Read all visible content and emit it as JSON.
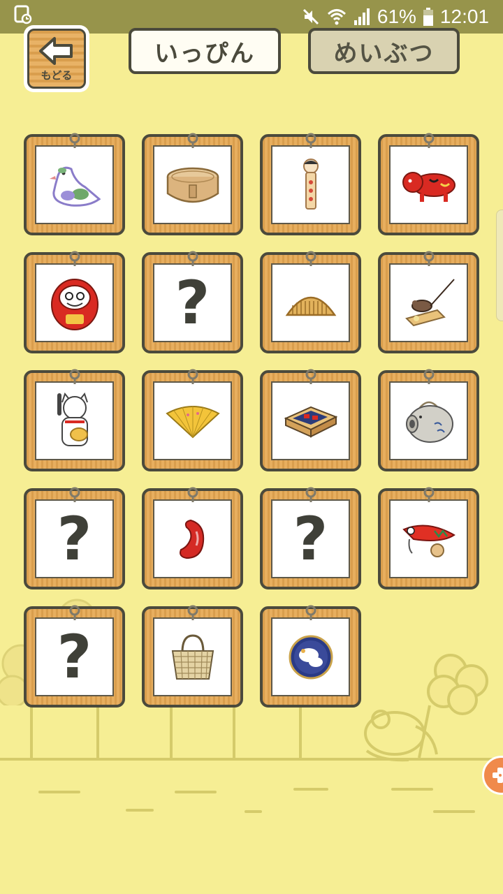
{
  "status_bar": {
    "battery_percent": "61%",
    "time": "12:01",
    "icons": [
      "screenshot-notification-icon",
      "mute-icon",
      "wifi-icon",
      "signal-icon",
      "battery-icon"
    ]
  },
  "header": {
    "back_label": "もどる",
    "tabs": [
      {
        "label": "いっぴん",
        "selected": true
      },
      {
        "label": "めいぶつ",
        "selected": false
      }
    ]
  },
  "collection": {
    "unknown_symbol": "?",
    "items": [
      {
        "icon": "dove-figurine-icon",
        "discovered": true
      },
      {
        "icon": "bento-box-icon",
        "discovered": true
      },
      {
        "icon": "kokeshi-doll-icon",
        "discovered": true
      },
      {
        "icon": "red-cow-akabeko-icon",
        "discovered": true
      },
      {
        "icon": "daruma-doll-icon",
        "discovered": true
      },
      {
        "icon": "unknown-item-icon",
        "discovered": false
      },
      {
        "icon": "wooden-comb-icon",
        "discovered": true
      },
      {
        "icon": "mouse-trap-icon",
        "discovered": true
      },
      {
        "icon": "lucky-cat-icon",
        "discovered": true
      },
      {
        "icon": "folding-fan-icon",
        "discovered": true
      },
      {
        "icon": "matchbox-icon",
        "discovered": true
      },
      {
        "icon": "pig-mosquito-coil-holder-icon",
        "discovered": true
      },
      {
        "icon": "unknown-item-icon",
        "discovered": false
      },
      {
        "icon": "red-bean-icon",
        "discovered": true
      },
      {
        "icon": "unknown-item-icon",
        "discovered": false
      },
      {
        "icon": "carp-toy-icon",
        "discovered": true
      },
      {
        "icon": "unknown-item-icon",
        "discovered": false
      },
      {
        "icon": "woven-basket-bag-icon",
        "discovered": true
      },
      {
        "icon": "decorative-plate-icon",
        "discovered": true
      }
    ]
  },
  "colors": {
    "background": "#f6ee94",
    "status_bar": "#97944b",
    "card_wood": "#e5a751",
    "outline": "#4b4a3c",
    "fab": "#f08a4b"
  }
}
